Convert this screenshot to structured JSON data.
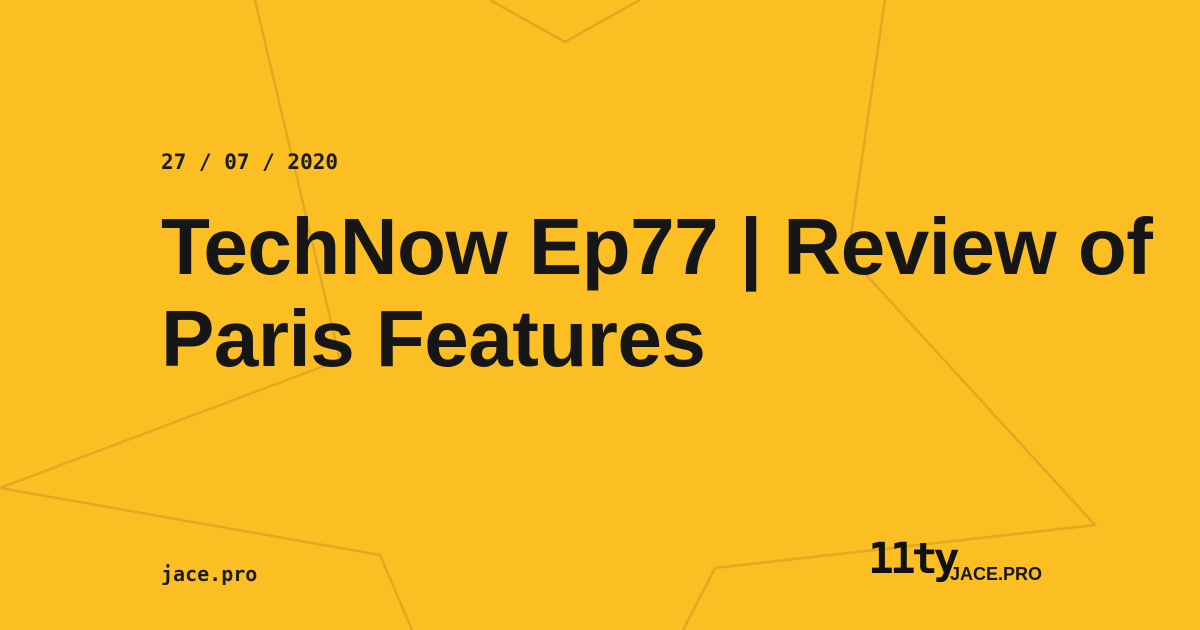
{
  "card": {
    "date": "27 / 07 / 2020",
    "title": "TechNow Ep77 | Review of Paris Features",
    "site_url": "jace.pro",
    "logo_text": "11ty",
    "brand": "JACE.PRO"
  },
  "colors": {
    "background": "#fbbf24",
    "text": "#161616",
    "star_outline": "#d9a421"
  }
}
